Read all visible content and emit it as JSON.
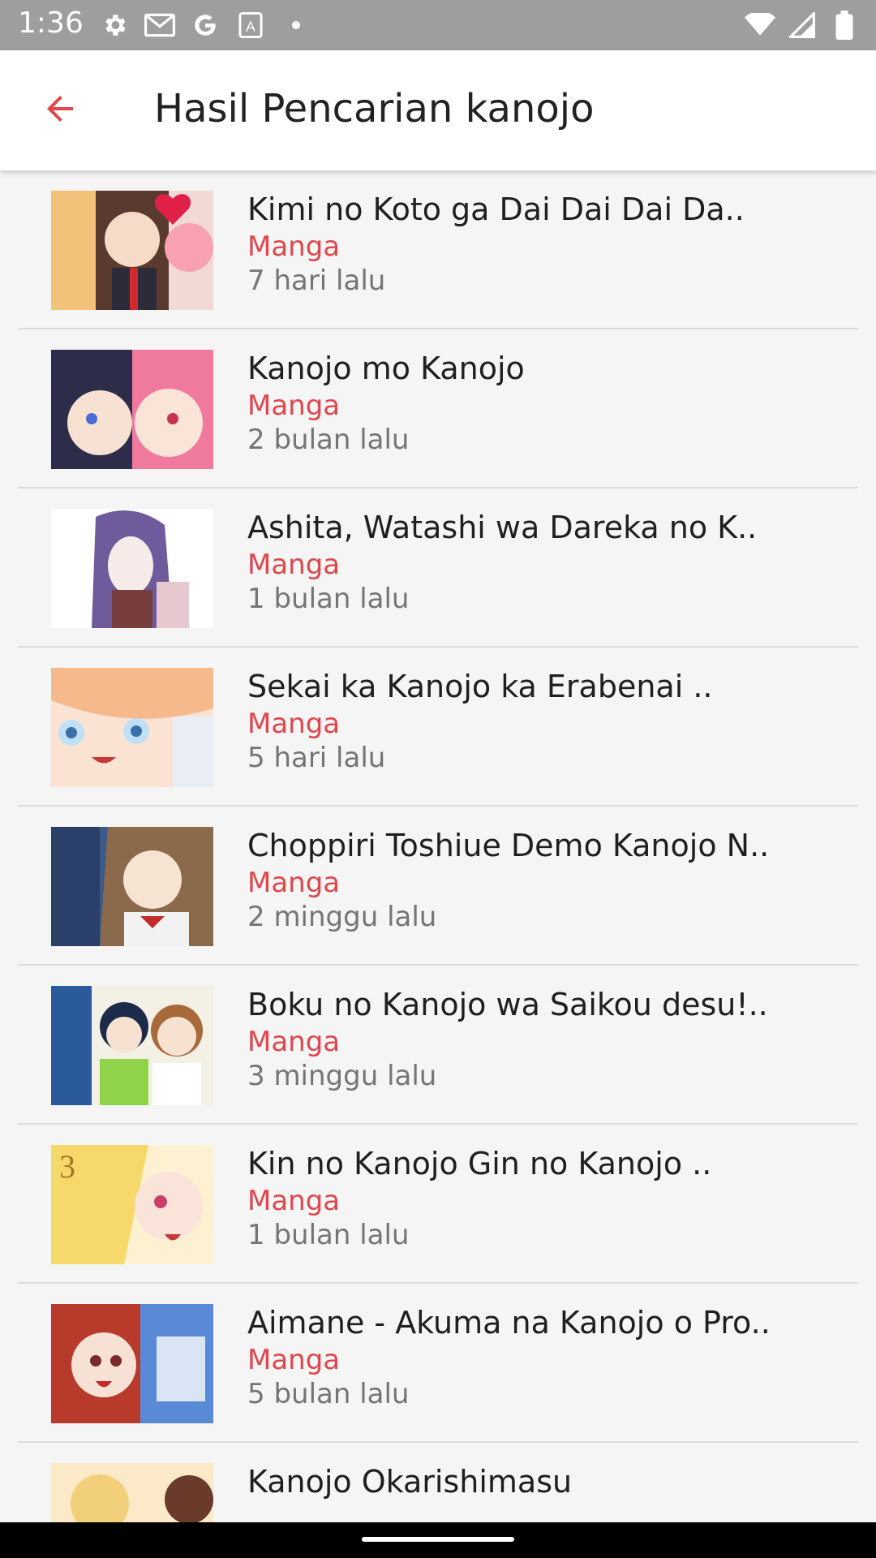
{
  "status_bar": {
    "time": "1:36",
    "left_icons": [
      "gear-icon",
      "gmail-icon",
      "google-icon",
      "keyboard-icon",
      "dot-icon"
    ],
    "right_icons": [
      "wifi-icon",
      "signal-icon",
      "battery-icon"
    ]
  },
  "app_bar": {
    "title": "Hasil Pencarian kanojo",
    "back_icon": "arrow-back-icon",
    "accent": "#e0474c"
  },
  "results": [
    {
      "title": "Kimi no Koto ga Dai Dai Dai Da..",
      "type": "Manga",
      "time": "7 hari lalu"
    },
    {
      "title": "Kanojo mo Kanojo",
      "type": "Manga",
      "time": "2 bulan lalu"
    },
    {
      "title": "Ashita, Watashi wa Dareka no K..",
      "type": "Manga",
      "time": "1 bulan lalu"
    },
    {
      "title": "Sekai ka Kanojo ka Erabenai   ..",
      "type": "Manga",
      "time": "5 hari lalu"
    },
    {
      "title": "Choppiri Toshiue Demo Kanojo N..",
      "type": "Manga",
      "time": "2 minggu lalu"
    },
    {
      "title": "Boku no Kanojo wa Saikou desu!..",
      "type": "Manga",
      "time": "3 minggu lalu"
    },
    {
      "title": "Kin no Kanojo Gin no Kanojo   ..",
      "type": "Manga",
      "time": "1 bulan lalu"
    },
    {
      "title": "Aimane - Akuma na Kanojo o Pro..",
      "type": "Manga",
      "time": "5 bulan lalu"
    },
    {
      "title": "Kanojo Okarishimasu",
      "type": "",
      "time": ""
    }
  ]
}
